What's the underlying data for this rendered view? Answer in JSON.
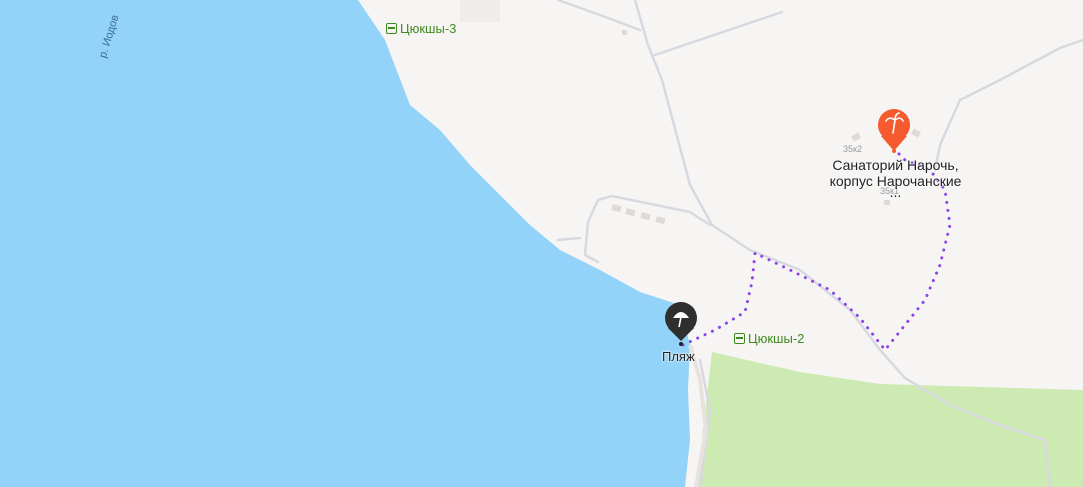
{
  "map": {
    "water_color": "#94d3f9",
    "land_color": "#f6f5f3",
    "forest_color": "#cdeab2",
    "route_color": "#8b45e8"
  },
  "labels": {
    "river": "р. Иодов",
    "stop_top": "Цюкшы-3",
    "stop_mid": "Цюкшы-2",
    "beach": "Пляж",
    "sanatorium_line1": "Санаторий Нарочь,",
    "sanatorium_line2": "корпус Нарочанские",
    "sanatorium_more": "...",
    "house_1": "35к2",
    "house_2": "35к1"
  },
  "markers": {
    "sanatorium_icon": "palm-tree-icon",
    "beach_icon": "umbrella-icon",
    "stop_icon": "bus-stop-icon"
  }
}
